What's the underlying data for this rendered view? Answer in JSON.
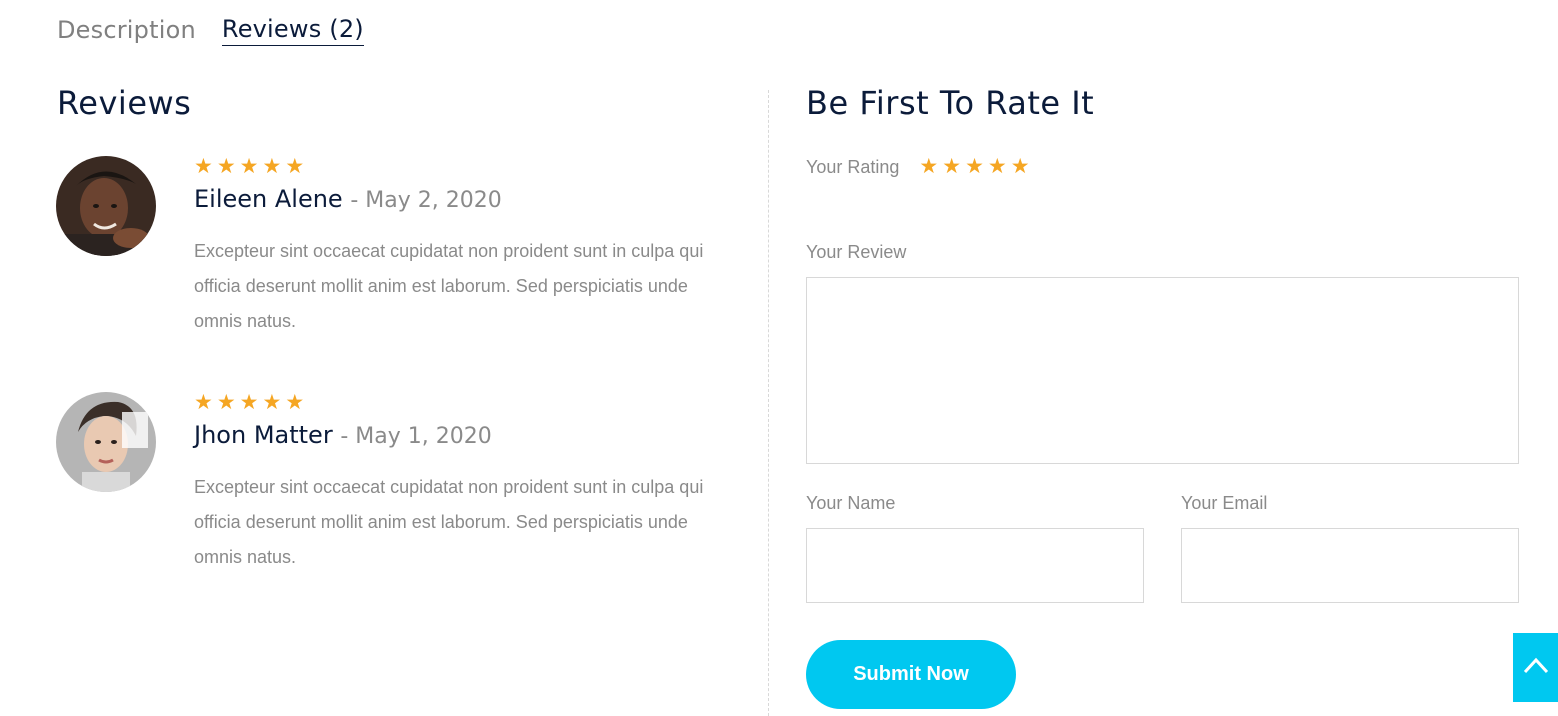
{
  "tabs": [
    {
      "label": "Description"
    },
    {
      "label": "Reviews (2)"
    }
  ],
  "reviews_section": {
    "title": "Reviews",
    "items": [
      {
        "name": "Eileen Alene",
        "separator": "- ",
        "date": "May 2, 2020",
        "stars": 5,
        "text": "Excepteur sint occaecat cupidatat non proident sunt in culpa qui officia deserunt mollit anim est laborum. Sed perspiciatis unde omnis natus."
      },
      {
        "name": "Jhon Matter",
        "separator": "- ",
        "date": "May 1, 2020",
        "stars": 5,
        "text": "Excepteur sint occaecat cupidatat non proident sunt in culpa qui officia deserunt mollit anim est laborum. Sed perspiciatis unde omnis natus."
      }
    ]
  },
  "form": {
    "title": "Be First To Rate It",
    "rating_label": "Your Rating",
    "rating_stars": 5,
    "review_label": "Your Review",
    "review_value": "",
    "name_label": "Your Name",
    "name_value": "",
    "email_label": "Your Email",
    "email_value": "",
    "submit_label": "Submit Now"
  },
  "colors": {
    "accent": "#00c8f0",
    "star": "#f5a623",
    "heading": "#0b1b3a",
    "muted": "#8a8a8a"
  },
  "icons": {
    "star": "star-icon",
    "back_to_top": "chevron-up-icon"
  }
}
